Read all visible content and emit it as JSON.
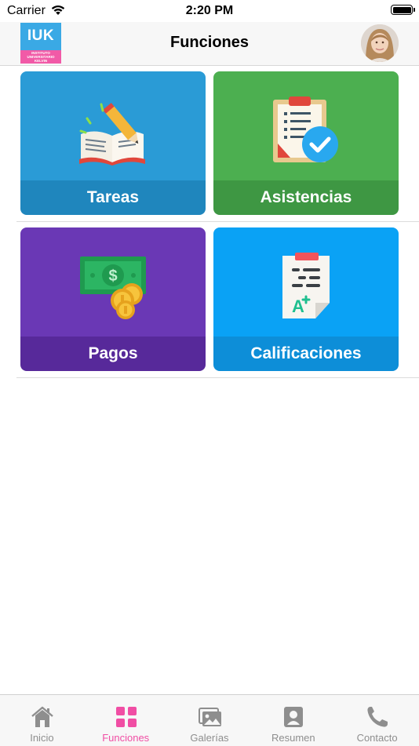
{
  "status_bar": {
    "carrier": "Carrier",
    "time": "2:20 PM"
  },
  "header": {
    "logo_text": "IUK",
    "logo_subtext": [
      "INSTITUTO",
      "UNIVERSITARIO",
      "KELVIN"
    ],
    "title": "Funciones"
  },
  "tiles": [
    {
      "label": "Tareas",
      "icon": "book-pencil-icon",
      "color": "#2a9bd6",
      "band": "#1f86bd"
    },
    {
      "label": "Asistencias",
      "icon": "clipboard-check-icon",
      "color": "#4caf50",
      "band": "#3e9743"
    },
    {
      "label": "Pagos",
      "icon": "money-coins-icon",
      "color": "#6a38b5",
      "band": "#57299a"
    },
    {
      "label": "Calificaciones",
      "icon": "grade-sheet-icon",
      "color": "#0aa2f5",
      "band": "#0d8ed8"
    }
  ],
  "tab_bar": {
    "active_color": "#f04ea4",
    "items": [
      {
        "label": "Inicio",
        "icon": "home-icon"
      },
      {
        "label": "Funciones",
        "icon": "grid-icon",
        "active": true
      },
      {
        "label": "Galerías",
        "icon": "gallery-icon"
      },
      {
        "label": "Resumen",
        "icon": "profile-card-icon"
      },
      {
        "label": "Contacto",
        "icon": "phone-icon"
      }
    ]
  }
}
